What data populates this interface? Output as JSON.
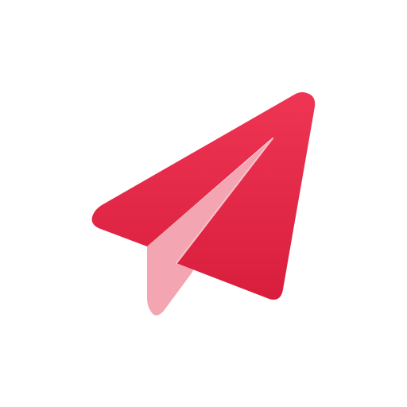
{
  "icon": {
    "name": "paper-plane-icon",
    "colors": {
      "background": "#ffffff",
      "main_wing_top": "#ee3553",
      "main_wing_bottom": "#d81e3c",
      "fold": "#f3a6b1",
      "crease_line": "#f7c3cb"
    }
  }
}
